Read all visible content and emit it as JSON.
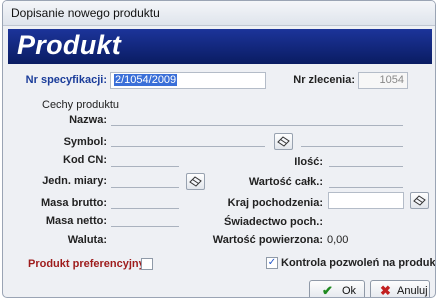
{
  "window": {
    "title": "Dopisanie nowego produktu"
  },
  "banner": {
    "title": "Produkt"
  },
  "spec": {
    "label": "Nr specyfikacji:",
    "value": "2/1054/2009"
  },
  "order": {
    "label": "Nr zlecenia:",
    "value": "1054"
  },
  "features": {
    "label": "Cechy produktu"
  },
  "fields": {
    "name": "Nazwa:",
    "symbol": "Symbol:",
    "cn_code": "Kod CN:",
    "quantity": "Ilość:",
    "unit": "Jedn. miary:",
    "total_value": "Wartość całk.:",
    "gross_mass": "Masa brutto:",
    "origin_country": "Kraj pochodzenia:",
    "net_mass": "Masa netto:",
    "origin_cert": "Świadectwo poch.:",
    "currency": "Waluta:",
    "customs_value_label": "Wartość powierzona:",
    "customs_value": "0,00"
  },
  "preferential": {
    "label": "Produkt preferencyjny:",
    "checked": false
  },
  "permits": {
    "label": "Kontrola pozwoleń na produkty",
    "checked": true
  },
  "buttons": {
    "ok": "Ok",
    "cancel": "Anuluj"
  },
  "icons": {
    "lookup": "eraser-lookup-icon",
    "ok": "check-icon",
    "cancel": "x-icon"
  },
  "colors": {
    "banner": "#0a1c62",
    "label_blue": "#1b3d9a",
    "label_red": "#9e1b1b",
    "ok_green": "#1f8a1f",
    "cancel_red": "#c22020"
  }
}
